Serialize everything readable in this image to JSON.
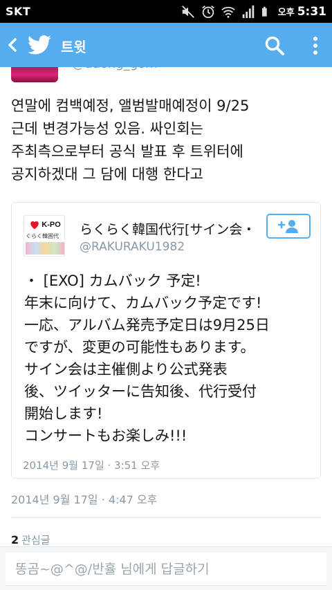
{
  "status_bar": {
    "carrier": "SKT",
    "time_ampm": "오후",
    "time": "5:31",
    "icons": [
      "mute-icon",
      "alarm-icon",
      "wifi-icon",
      "signal-icon",
      "battery-icon"
    ]
  },
  "top_bar": {
    "title": "트윗",
    "color": "#55acee",
    "icons": [
      "back-arrow-icon",
      "twitter-bird-icon",
      "search-icon",
      "overflow-menu-icon"
    ]
  },
  "tweet": {
    "handle": "@ddong_gom",
    "lines": [
      "연말에 컴백예정, 앨범발매예정이 9/25",
      "근데 변경가능성 있음. 싸인회는",
      "주최측으로부터 공식 발표 후 트위터에",
      "공지하겠대 그 담에 대행 한다고"
    ],
    "timestamp": "2014년 9월 17일 · 4:47 오후",
    "favorites_count": "2",
    "favorites_label": "관심글"
  },
  "quoted_tweet": {
    "avatar_text": {
      "top": "K-PO",
      "mid": "くらく韓国代"
    },
    "name": "らくらく韓国代行[サイン会・",
    "handle": "@RAKURAKU1982",
    "lines": [
      "・ [EXO] カムバック 予定!",
      "年末に向けて、カムバック予定です!",
      "一応、アルバム発売予定日は9月25日",
      "ですが、変更の可能性もあります。",
      "サイン会は主催側より公式発表",
      "後、ツイッターに告知後、代行受付",
      "開始します!",
      "コンサートもお楽しみ!!!"
    ],
    "timestamp": "2014년 9월 17일 · 3:51 오후",
    "follow_icon": "add-user-icon"
  },
  "reply": {
    "placeholder": "똥곰~@^@/반휼 님에게 답글하기"
  }
}
